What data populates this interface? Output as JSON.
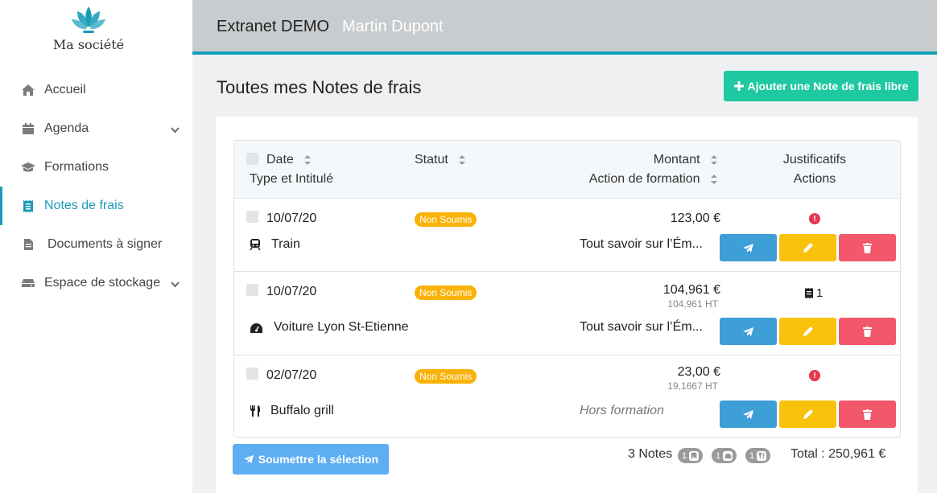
{
  "brand": {
    "name": "Ma société",
    "accent": "#1b9ab6"
  },
  "topbar": {
    "app_name": "Extranet DEMO",
    "user_name": "Martin Dupont"
  },
  "sidebar": {
    "items": [
      {
        "label": "Accueil",
        "icon": "home-icon"
      },
      {
        "label": "Agenda",
        "icon": "calendar-icon",
        "has_chevron": true
      },
      {
        "label": "Formations",
        "icon": "graduation-cap-icon"
      },
      {
        "label": "Notes de frais",
        "icon": "receipt-icon",
        "active": true
      },
      {
        "label": "Documents à signer",
        "icon": "document-icon"
      },
      {
        "label": "Espace de stockage",
        "icon": "storage-icon",
        "has_chevron": true
      }
    ]
  },
  "page": {
    "title": "Toutes mes Notes de frais",
    "add_button": "Ajouter une Note de frais libre"
  },
  "table": {
    "headers": {
      "date": "Date",
      "type": "Type et Intitulé",
      "status": "Statut",
      "amount": "Montant",
      "training": "Action de formation",
      "receipts": "Justificatifs",
      "actions": "Actions"
    },
    "rows": [
      {
        "date": "10/07/20",
        "status": "Non Soumis",
        "amount": "123,00 €",
        "amount_ht": "",
        "type_icon": "train-icon",
        "label": "Train",
        "training": "Tout savoir sur l’Ém...",
        "training_italic": false,
        "receipt": "warning",
        "receipt_count": ""
      },
      {
        "date": "10/07/20",
        "status": "Non Soumis",
        "amount": "104,961 €",
        "amount_ht": "104,961 HT",
        "type_icon": "speedometer-icon",
        "label": "Voiture Lyon St-Etienne",
        "training": "Tout savoir sur l’Ém...",
        "training_italic": false,
        "receipt": "file",
        "receipt_count": "1"
      },
      {
        "date": "02/07/20",
        "status": "Non Soumis",
        "amount": "23,00 €",
        "amount_ht": "19,1667 HT",
        "type_icon": "cutlery-icon",
        "label": "Buffalo grill",
        "training": "Hors formation",
        "training_italic": true,
        "receipt": "warning",
        "receipt_count": ""
      }
    ]
  },
  "footer": {
    "submit_button": "Soumettre la sélection",
    "count": "3 Notes",
    "pills": [
      {
        "count": "1",
        "icon": "train-icon"
      },
      {
        "count": "1",
        "icon": "speedometer-icon"
      },
      {
        "count": "1",
        "icon": "cutlery-icon"
      }
    ],
    "total": "Total : 250,961 €"
  },
  "colors": {
    "status_badge": "#f9b208",
    "send_button": "#3e9ed6",
    "edit_button": "#f9c20a",
    "delete_button": "#f2576c",
    "add_button": "#1ec8a0",
    "submit_button": "#5daef3"
  }
}
